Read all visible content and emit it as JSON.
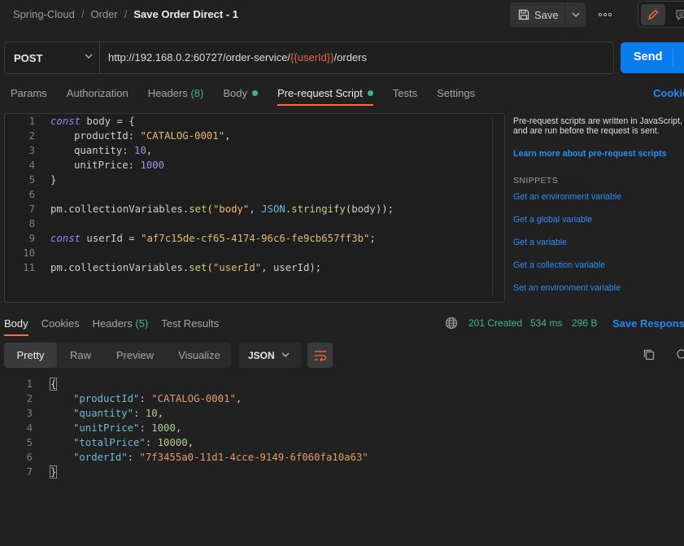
{
  "breadcrumb": {
    "root": "Spring-Cloud",
    "folder": "Order",
    "separator": "/",
    "current": "Save Order Direct - 1"
  },
  "header": {
    "save_label": "Save"
  },
  "request": {
    "method": "POST",
    "url_prefix": "http://192.168.0.2:60727/order-service/",
    "url_variable": "{{userId}}",
    "url_suffix": "/orders",
    "send_label": "Send"
  },
  "tabs": [
    {
      "label": "Params"
    },
    {
      "label": "Authorization"
    },
    {
      "label": "Headers",
      "count": "(8)"
    },
    {
      "label": "Body"
    },
    {
      "label": "Pre-request Script"
    },
    {
      "label": "Tests"
    },
    {
      "label": "Settings"
    }
  ],
  "cookies_link": "Cookies",
  "script": {
    "line_numbers": [
      "1",
      "2",
      "3",
      "4",
      "5",
      "6",
      "7",
      "8",
      "9",
      "10",
      "11"
    ],
    "l1": {
      "kw": "const",
      "rest": " body = {"
    },
    "l2": {
      "key": "productId",
      "colon": ": ",
      "val": "\"CATALOG-0001\"",
      "comma": ","
    },
    "l3": {
      "key": "quantity",
      "colon": ": ",
      "val": "10",
      "comma": ","
    },
    "l4": {
      "key": "unitPrice",
      "colon": ": ",
      "val": "1000"
    },
    "l5": "}",
    "l7": {
      "a": "pm.collectionVariables.",
      "fn": "set",
      "b": "(",
      "s": "\"body\"",
      "c": ", ",
      "obj": "JSON",
      "d": ".",
      "fn2": "stringify",
      "e": "(body));"
    },
    "l9": {
      "kw": "const",
      "rest": " userId = ",
      "s": "\"af7c15de-cf65-4174-96c6-fe9cb657ff3b\"",
      "end": ";"
    },
    "l11": {
      "a": "pm.collectionVariables.",
      "fn": "set",
      "b": "(",
      "s": "\"userId\"",
      "c": ", userId);"
    }
  },
  "side_panel": {
    "description": "Pre-request scripts are written in JavaScript, and are run before the request is sent.",
    "learn_link": "Learn more about pre-request scripts",
    "snippets_heading": "SNIPPETS",
    "snippets": [
      "Get an environment variable",
      "Get a global variable",
      "Get a variable",
      "Get a collection variable",
      "Set an environment variable"
    ]
  },
  "response": {
    "tabs": [
      {
        "label": "Body"
      },
      {
        "label": "Cookies"
      },
      {
        "label": "Headers",
        "count": "(5)"
      },
      {
        "label": "Test Results"
      }
    ],
    "status": "201 Created",
    "time": "534 ms",
    "size": "296 B",
    "save_label": "Save Response",
    "view_tabs": [
      "Pretty",
      "Raw",
      "Preview",
      "Visualize"
    ],
    "format": "JSON",
    "line_numbers": [
      "1",
      "2",
      "3",
      "4",
      "5",
      "6",
      "7"
    ],
    "open_brace": "{",
    "close_brace": "}",
    "fields": [
      {
        "key": "\"productId\"",
        "sep": ": ",
        "val": "\"CATALOG-0001\"",
        "comma": ","
      },
      {
        "key": "\"quantity\"",
        "sep": ": ",
        "val": "10",
        "comma": ","
      },
      {
        "key": "\"unitPrice\"",
        "sep": ": ",
        "val": "1000",
        "comma": ","
      },
      {
        "key": "\"totalPrice\"",
        "sep": ": ",
        "val": "10000",
        "comma": ","
      },
      {
        "key": "\"orderId\"",
        "sep": ": ",
        "val": "\"7f3455a0-11d1-4cce-9149-6f060fa10a63\"",
        "comma": ""
      }
    ]
  },
  "colors": {
    "accent": "#ff6c37",
    "send": "#097bed",
    "success": "#3fb97a",
    "link": "#1f8bf1"
  }
}
